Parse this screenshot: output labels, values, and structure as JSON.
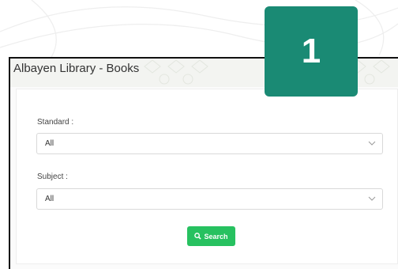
{
  "window": {
    "title": "Albayen Library - Books"
  },
  "step_badge": {
    "number": "1",
    "color": "#1a8a74"
  },
  "form": {
    "standard": {
      "label": "Standard :",
      "selected": "All"
    },
    "subject": {
      "label": "Subject :",
      "selected": "All"
    },
    "search_button": {
      "label": "Search",
      "icon": "search-icon",
      "color": "#27c160"
    }
  }
}
